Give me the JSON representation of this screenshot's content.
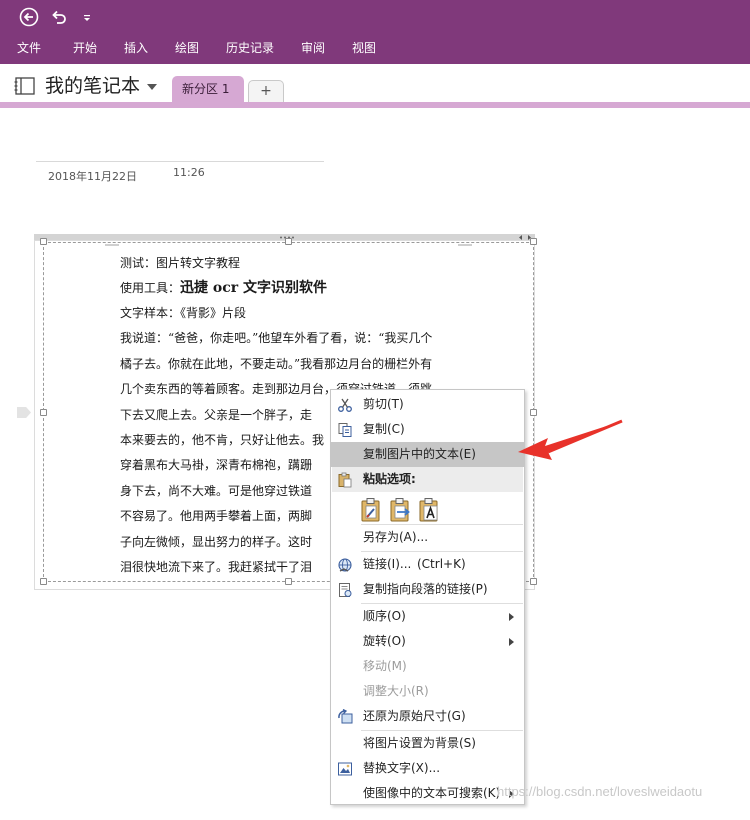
{
  "ribbon": {
    "tabs": [
      "文件",
      "开始",
      "插入",
      "绘图",
      "历史记录",
      "审阅",
      "视图"
    ]
  },
  "notebook": {
    "title": "我的笔记本",
    "section_tab": "新分区 1",
    "add_tab": "+"
  },
  "page": {
    "date": "2018年11月22日",
    "time": "11:26"
  },
  "image_text": {
    "line1": "测试：图片转文字教程",
    "line2_prefix": "使用工具：",
    "line2_bold": "迅捷 ocr 文字识别软件",
    "line3": "文字样本：《背影》片段",
    "lines": [
      "我说道：“爸爸，你走吧。”他望车外看了看，说：“我买几个",
      "橘子去。你就在此地，不要走动。”我看那边月台的栅栏外有",
      "几个卖东西的等着顾客。走到那边月台，须穿过铁道，须跳",
      "下去又爬上去。父亲是一个胖子，走",
      "本来要去的，他不肯，只好让他去。我",
      "穿着黑布大马褂，深青布棉袍，蹒跚",
      "身下去，尚不大难。可是他穿过铁道",
      "不容易了。他用两手攀着上面，两脚",
      "子向左微倾，显出努力的样子。这时",
      "泪很快地流下来了。我赶紧拭干了泪"
    ]
  },
  "context_menu": {
    "cut": "剪切(T)",
    "copy": "复制(C)",
    "copy_text_from_picture": "复制图片中的文本(E)",
    "paste_options": "粘贴选项:",
    "save_as": "另存为(A)...",
    "link": "链接(I)...",
    "link_shortcut": "(Ctrl+K)",
    "copy_link_to_paragraph": "复制指向段落的链接(P)",
    "order": "顺序(O)",
    "rotate": "旋转(O)",
    "move": "移动(M)",
    "resize": "调整大小(R)",
    "restore_original_size": "还原为原始尺寸(G)",
    "set_as_background": "将图片设置为背景(S)",
    "alt_text": "替换文字(X)...",
    "make_text_searchable": "使图像中的文本可搜索(K)"
  },
  "watermark": "https://blog.csdn.net/loveslweidaotu",
  "colors": {
    "ribbon": "#80397b",
    "section_tab": "#d6a8d3",
    "highlight": "#c6c6c6",
    "arrow": "#e8322a"
  }
}
